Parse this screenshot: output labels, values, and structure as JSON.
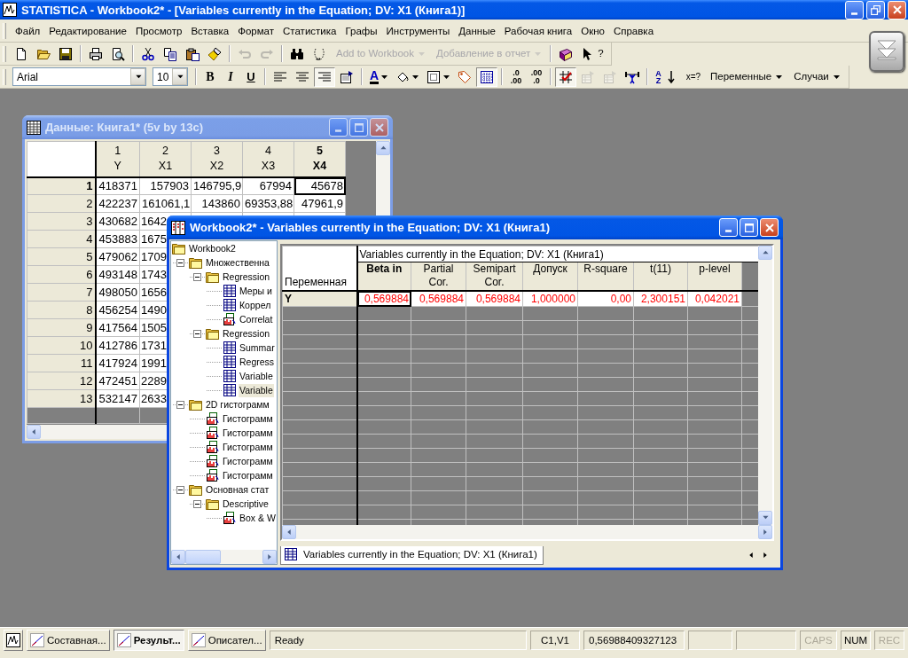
{
  "window": {
    "title": "STATISTICA - Workbook2* - [Variables currently in the Equation; DV: X1 (Книга1)]"
  },
  "menu": [
    {
      "label": "Файл"
    },
    {
      "label": "Редактирование"
    },
    {
      "label": "Просмотр"
    },
    {
      "label": "Вставка"
    },
    {
      "label": "Формат"
    },
    {
      "label": "Статистика"
    },
    {
      "label": "Графы"
    },
    {
      "label": "Инструменты"
    },
    {
      "label": "Данные"
    },
    {
      "label": "Рабочая книга"
    },
    {
      "label": "Окно"
    },
    {
      "label": "Справка"
    }
  ],
  "toolbar_1": [
    {
      "kind": "icon",
      "disabled": false
    },
    {
      "kind": "icon",
      "disabled": false
    },
    {
      "kind": "icon",
      "disabled": false
    },
    {
      "kind": "separator"
    },
    {
      "kind": "icon",
      "disabled": false
    },
    {
      "kind": "icon",
      "disabled": false
    },
    {
      "kind": "separator"
    },
    {
      "kind": "icon",
      "disabled": false
    },
    {
      "kind": "icon",
      "disabled": false
    },
    {
      "kind": "icon",
      "disabled": false
    },
    {
      "kind": "icon",
      "disabled": false
    },
    {
      "kind": "separator"
    },
    {
      "kind": "icon",
      "disabled": true
    },
    {
      "kind": "icon",
      "disabled": true
    },
    {
      "kind": "separator"
    },
    {
      "kind": "icon",
      "disabled": false
    },
    {
      "kind": "icon",
      "disabled": false
    },
    {
      "kind": "dropdown",
      "label": "Add to Workbook",
      "disabled": true
    },
    {
      "kind": "dropdown",
      "label": "Добавление в отчет",
      "disabled": true
    },
    {
      "kind": "separator"
    },
    {
      "kind": "icon",
      "disabled": false
    },
    {
      "kind": "help",
      "label": "?",
      "disabled": false
    }
  ],
  "toolbar_2": [
    {
      "kind": "combo",
      "value": "Arial"
    },
    {
      "kind": "combo",
      "value": "10"
    },
    {
      "kind": "separator"
    },
    {
      "kind": "bold",
      "label": "B",
      "pressed": false
    },
    {
      "kind": "italic",
      "label": "I",
      "pressed": false
    },
    {
      "kind": "underline",
      "label": "U",
      "pressed": false
    },
    {
      "kind": "separator"
    },
    {
      "kind": "icon",
      "pressed": false,
      "disabled": false
    },
    {
      "kind": "icon",
      "pressed": false,
      "disabled": false
    },
    {
      "kind": "icon",
      "pressed": true,
      "disabled": false
    },
    {
      "kind": "icon",
      "pressed": false,
      "disabled": false
    },
    {
      "kind": "separator"
    },
    {
      "kind": "color_text",
      "label": "A",
      "pressed": false
    },
    {
      "kind": "icon_dropdown",
      "pressed": false,
      "disabled": false
    },
    {
      "kind": "icon_dropdown",
      "pressed": false,
      "disabled": false
    },
    {
      "kind": "icon",
      "pressed": false,
      "disabled": false
    },
    {
      "kind": "icon",
      "pressed": true,
      "disabled": false
    },
    {
      "kind": "separator"
    },
    {
      "kind": "lines",
      "label": ".0\n.00",
      "pressed": false
    },
    {
      "kind": "lines",
      "label": ".00\n.0",
      "pressed": false
    },
    {
      "kind": "separator"
    },
    {
      "kind": "icon",
      "pressed": true,
      "disabled": false
    },
    {
      "kind": "icon",
      "pressed": false,
      "disabled": true
    },
    {
      "kind": "icon",
      "pressed": false,
      "disabled": true
    },
    {
      "kind": "icon",
      "pressed": false,
      "disabled": false
    },
    {
      "kind": "separator"
    },
    {
      "kind": "sort",
      "label": "A\nZ",
      "pressed": false
    },
    {
      "kind": "text",
      "label": "x=?",
      "pressed": false
    },
    {
      "kind": "dropdown",
      "label": "Переменные",
      "disabled": false
    },
    {
      "kind": "dropdown",
      "label": "Случаи",
      "disabled": false
    }
  ],
  "data_window": {
    "title": "Данные: Книга1* (5v by 13c)",
    "active": false,
    "columns": [
      {
        "number": "1",
        "name": "Y",
        "selected": false
      },
      {
        "number": "2",
        "name": "X1",
        "selected": false
      },
      {
        "number": "3",
        "name": "X2",
        "selected": false
      },
      {
        "number": "4",
        "name": "X3",
        "selected": false
      },
      {
        "number": "5",
        "name": "X4",
        "selected": true
      }
    ],
    "rows": [
      {
        "label": "1",
        "selected": true,
        "cells": [
          "418371",
          "157903",
          "146795,9",
          "67994",
          "45678"
        ]
      },
      {
        "label": "2",
        "selected": false,
        "cells": [
          "422237",
          "161061,1",
          "143860",
          "69353,88",
          "47961,9"
        ]
      },
      {
        "label": "3",
        "selected": false,
        "cells": [
          "430682",
          "1642"
        ]
      },
      {
        "label": "4",
        "selected": false,
        "cells": [
          "453883",
          "1675"
        ]
      },
      {
        "label": "5",
        "selected": false,
        "cells": [
          "479062",
          "1709"
        ]
      },
      {
        "label": "6",
        "selected": false,
        "cells": [
          "493148",
          "1743"
        ]
      },
      {
        "label": "7",
        "selected": false,
        "cells": [
          "498050",
          "1656"
        ]
      },
      {
        "label": "8",
        "selected": false,
        "cells": [
          "456254",
          "1490"
        ]
      },
      {
        "label": "9",
        "selected": false,
        "cells": [
          "417564",
          "1505"
        ]
      },
      {
        "label": "10",
        "selected": false,
        "cells": [
          "412786",
          "1731"
        ]
      },
      {
        "label": "11",
        "selected": false,
        "cells": [
          "417924",
          "1991"
        ]
      },
      {
        "label": "12",
        "selected": false,
        "cells": [
          "472451",
          "2289"
        ]
      },
      {
        "label": "13",
        "selected": false,
        "cells": [
          "532147",
          "2633"
        ]
      }
    ]
  },
  "workbook_window": {
    "title": "Workbook2* - Variables currently in the Equation; DV: X1 (Книга1)",
    "active": true,
    "tree": [
      {
        "kind": "folder",
        "label": "Workbook2",
        "selected": false,
        "children": [
          {
            "kind": "folder",
            "label": "Множественна",
            "expanded": true,
            "selected": false,
            "children": [
              {
                "kind": "folder",
                "label": "Regression",
                "expanded": true,
                "selected": false,
                "children": [
                  {
                    "kind": "table",
                    "label": "Меры и",
                    "selected": false
                  },
                  {
                    "kind": "table",
                    "label": "Коррел",
                    "selected": false
                  },
                  {
                    "kind": "graph",
                    "label": "Correlat",
                    "selected": false
                  }
                ]
              },
              {
                "kind": "folder",
                "label": "Regression",
                "expanded": true,
                "selected": false,
                "children": [
                  {
                    "kind": "table",
                    "label": "Summar",
                    "selected": false
                  },
                  {
                    "kind": "table",
                    "label": "Regress",
                    "selected": false
                  },
                  {
                    "kind": "table",
                    "label": "Variable",
                    "selected": false
                  },
                  {
                    "kind": "table",
                    "label": "Variable",
                    "selected": true
                  }
                ]
              }
            ]
          },
          {
            "kind": "folder",
            "label": "2D гистограмм",
            "expanded": true,
            "selected": false,
            "children": [
              {
                "kind": "graph",
                "label": "Гистограмм",
                "selected": false
              },
              {
                "kind": "graph",
                "label": "Гистограмм",
                "selected": false
              },
              {
                "kind": "graph",
                "label": "Гистограмм",
                "selected": false
              },
              {
                "kind": "graph",
                "label": "Гистограмм",
                "selected": false
              },
              {
                "kind": "graph",
                "label": "Гистограмм",
                "selected": false
              }
            ]
          },
          {
            "kind": "folder",
            "label": "Основная стат",
            "expanded": true,
            "selected": false,
            "children": [
              {
                "kind": "folder",
                "label": "Descriptive",
                "expanded": true,
                "selected": false,
                "children": [
                  {
                    "kind": "graph",
                    "label": "Box & W",
                    "selected": false
                  }
                ]
              }
            ]
          }
        ]
      }
    ],
    "sheet": {
      "title": "Variables currently in the Equation; DV: X1 (Книга1)",
      "row_header": "Переменная",
      "columns": [
        {
          "label": "Beta in",
          "selected": true
        },
        {
          "label": "Partial\nCor.",
          "selected": false
        },
        {
          "label": "Semipart\nCor.",
          "selected": false
        },
        {
          "label": "Допуск",
          "selected": false
        },
        {
          "label": "R-square",
          "selected": false
        },
        {
          "label": "t(11)",
          "selected": false
        },
        {
          "label": "p-level",
          "selected": false
        }
      ],
      "rows": [
        {
          "label": "Y",
          "selected": true,
          "highlighted": true,
          "cells": [
            "0,569884",
            "0,569884",
            "0,569884",
            "1,000000",
            "0,00",
            "2,300151",
            "0,042021"
          ]
        }
      ]
    },
    "sheet_tab": "Variables currently in the Equation; DV: X1 (Книга1)"
  },
  "status_bar": {
    "tasks": [
      {
        "label": "Составная...",
        "selected": false
      },
      {
        "label": "Результ...",
        "selected": true
      },
      {
        "label": "Описател...",
        "selected": false
      }
    ],
    "message": "Ready",
    "cell": "C1,V1",
    "value": "0,56988409327123",
    "indicators": [
      {
        "label": "CAPS",
        "on": false
      },
      {
        "label": "NUM",
        "on": true
      },
      {
        "label": "REC",
        "on": false
      }
    ]
  }
}
